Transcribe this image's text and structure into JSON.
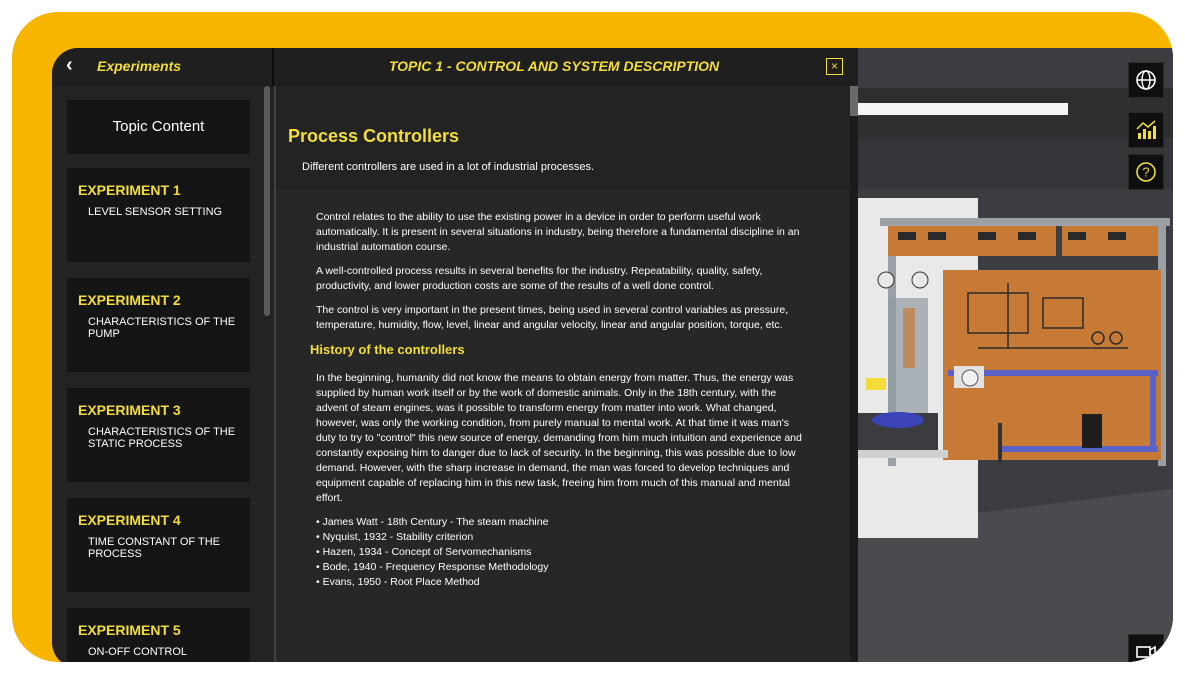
{
  "nav": {
    "back_label": "Experiments"
  },
  "topic": {
    "title": "TOPIC 1 - CONTROL AND SYSTEM DESCRIPTION",
    "close_glyph": "×"
  },
  "sidebar": {
    "header": "Topic Content",
    "experiments": [
      {
        "title": "EXPERIMENT 1",
        "subtitle": "LEVEL SENSOR SETTING"
      },
      {
        "title": "EXPERIMENT 2",
        "subtitle": "CHARACTERISTICS OF THE PUMP"
      },
      {
        "title": "EXPERIMENT 3",
        "subtitle": "CHARACTERISTICS OF THE STATIC PROCESS"
      },
      {
        "title": "EXPERIMENT 4",
        "subtitle": "TIME CONSTANT OF THE PROCESS"
      },
      {
        "title": "EXPERIMENT 5",
        "subtitle": "ON-OFF CONTROL"
      }
    ]
  },
  "content": {
    "title": "Process Controllers",
    "subtitle": "Different controllers are used in a lot of industrial processes.",
    "paragraphs": [
      "Control relates to the ability to use the existing power in a device in order to perform useful work automatically. It is present in several situations in industry, being therefore a fundamental discipline in an industrial automation course.",
      "A well-controlled process results in several benefits for the industry. Repeatability, quality, safety, productivity, and lower production costs are some of the results of a well done control.",
      "The control is very important in the present times, being used in several control variables as pressure, temperature, humidity, flow, level, linear and angular velocity, linear and angular position, torque, etc."
    ],
    "history_heading": "History of the controllers",
    "history_paragraph": "In the beginning, humanity did not know the means to obtain energy from matter. Thus, the energy was supplied by human work itself or by the work of domestic animals. Only in the 18th century, with the advent of steam engines, was it possible to transform energy from matter into work. What changed, however, was only the working condition, from purely manual to mental work. At that time it was man's duty to try to \"control\" this new source of energy, demanding from him much intuition and experience and constantly exposing him to danger due to lack of security. In the beginning, this was possible due to low demand. However, with the sharp increase in demand, the man was forced to develop techniques and equipment capable of replacing him in this new task, freeing him from much of this manual and mental effort.",
    "history_list": [
      "• James Watt - 18th Century - The steam machine",
      "• Nyquist, 1932 - Stability criterion",
      "• Hazen, 1934 - Concept of Servomechanisms",
      "• Bode, 1940 - Frequency Response Methodology",
      "• Evans, 1950 - Root Place Method"
    ]
  },
  "view_controls": [
    {
      "name": "globe-icon"
    },
    {
      "name": "chart-icon"
    },
    {
      "name": "help-icon"
    },
    {
      "name": "camera-icon"
    }
  ],
  "colors": {
    "frame": "#f7b500",
    "accent": "#f2dd3a",
    "panel": "#151516",
    "board": "#c67a35"
  }
}
